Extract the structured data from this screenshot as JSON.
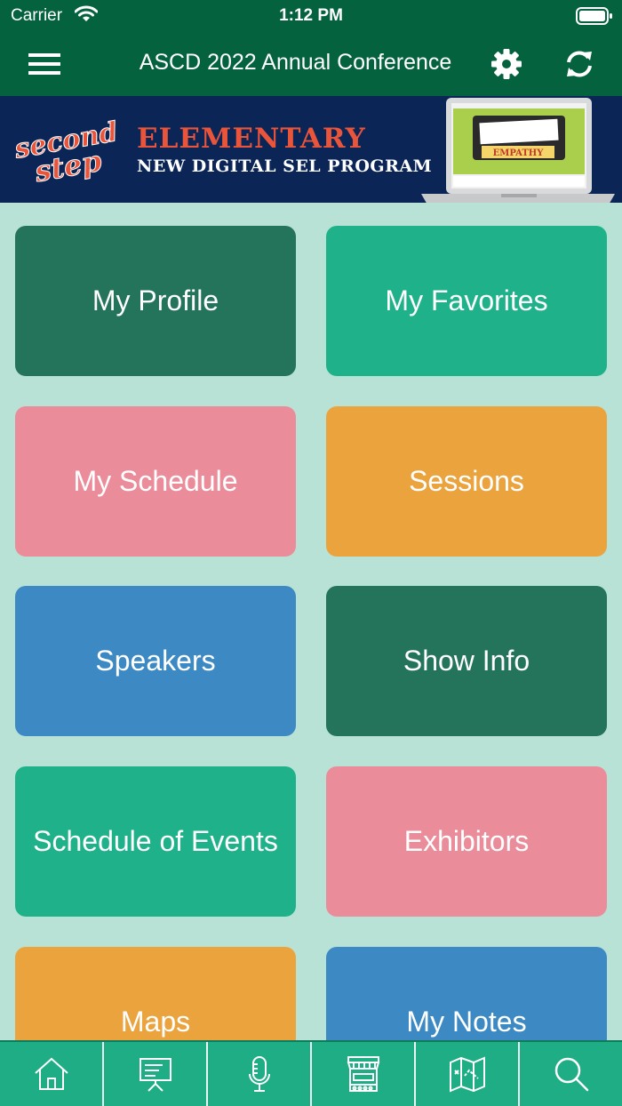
{
  "status_bar": {
    "carrier": "Carrier",
    "time": "1:12 PM"
  },
  "nav": {
    "title": "ASCD 2022 Annual Conference"
  },
  "banner": {
    "logo_text": [
      "second",
      "step"
    ],
    "title": "ELEMENTARY",
    "subtitle": "NEW DIGITAL SEL PROGRAM",
    "screen_label": "EMPATHY"
  },
  "tiles": [
    {
      "label": "My Profile",
      "color": "#24735b"
    },
    {
      "label": "My Favorites",
      "color": "#1fb28a"
    },
    {
      "label": "My Schedule",
      "color": "#eb8c9a"
    },
    {
      "label": "Sessions",
      "color": "#eba33e"
    },
    {
      "label": "Speakers",
      "color": "#3c89c4"
    },
    {
      "label": "Show Info",
      "color": "#24735b"
    },
    {
      "label": "Schedule of Events",
      "color": "#1fb28a"
    },
    {
      "label": "Exhibitors",
      "color": "#eb8c9a"
    },
    {
      "label": "Maps",
      "color": "#eba33e"
    },
    {
      "label": "My Notes",
      "color": "#3c89c4"
    }
  ],
  "tab_bar": {
    "icons": [
      "home-icon",
      "presentation-icon",
      "microphone-icon",
      "booth-icon",
      "map-icon",
      "search-icon"
    ]
  },
  "colors": {
    "header": "#04623f",
    "background": "#b9e2d6",
    "tab_bar": "#1fad85",
    "banner": "#0b2557",
    "banner_accent": "#e8553b"
  }
}
